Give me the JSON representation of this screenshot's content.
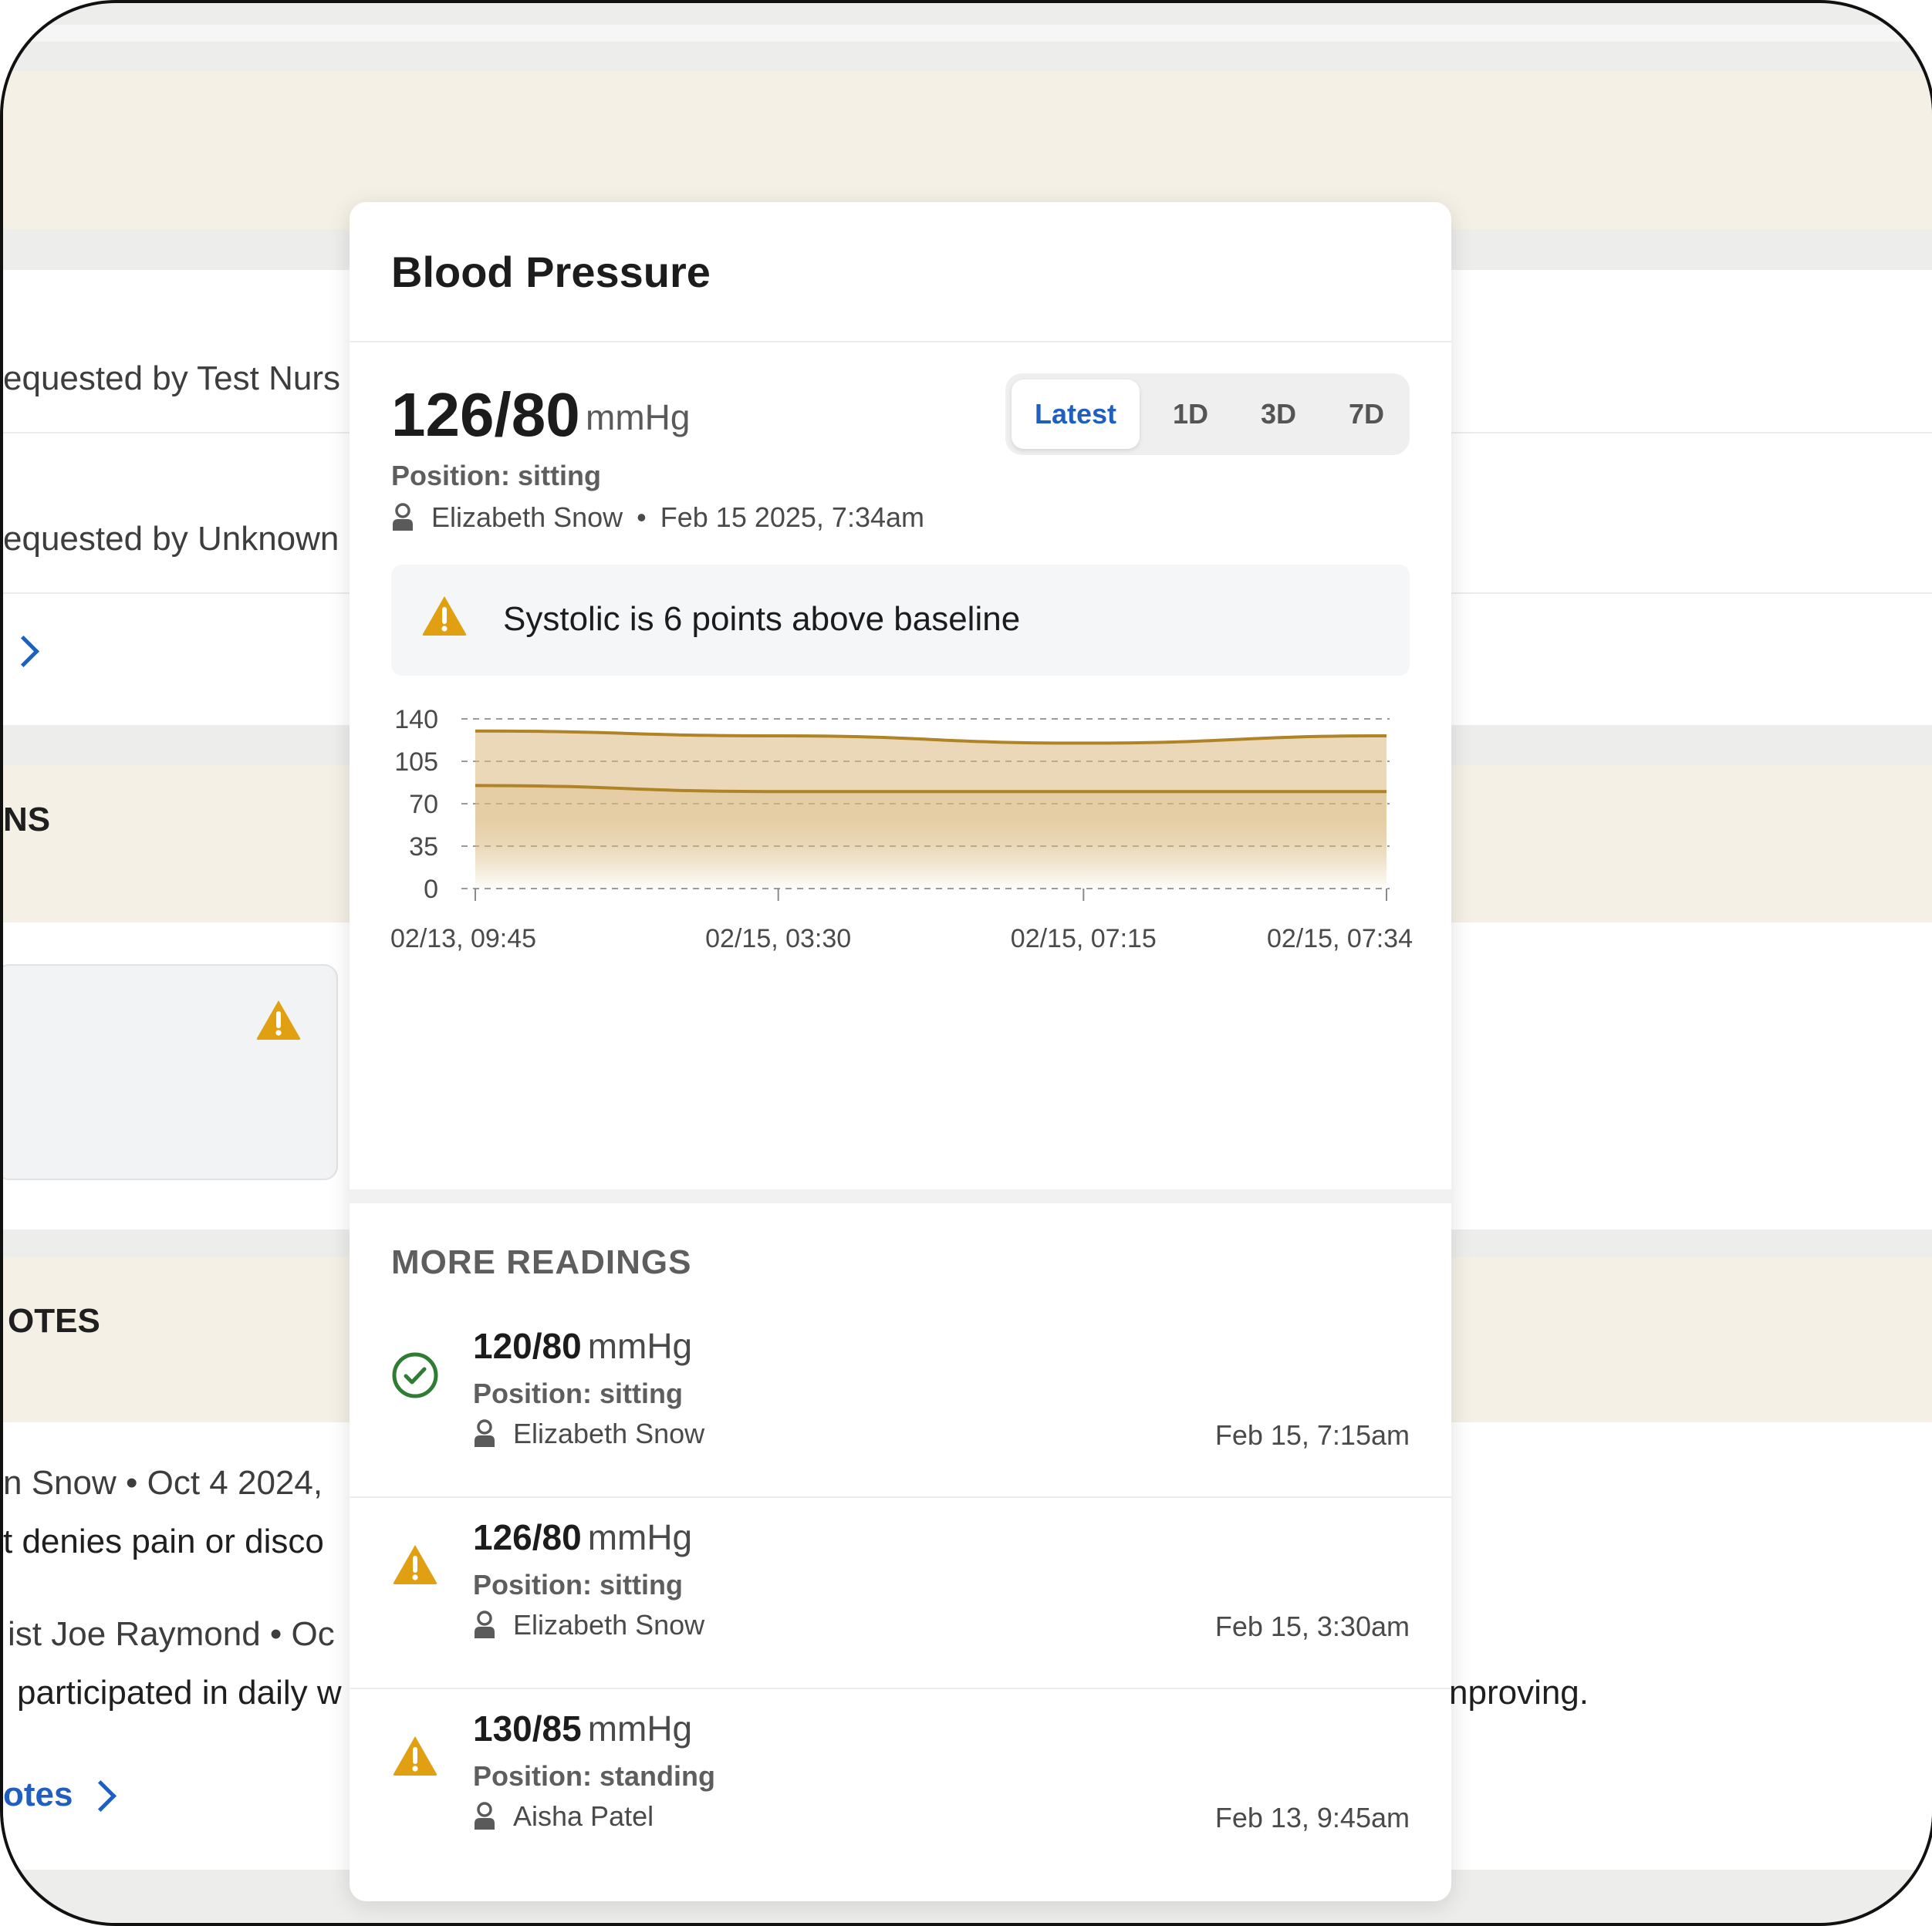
{
  "background": {
    "requested_1": "equested by Test Nurs",
    "requested_2": "equested by Unknown",
    "section_ns": "NS",
    "section_notes": "OTES",
    "note_line_1": "n Snow • Oct 4 2024,",
    "note_line_2": "t denies pain or disco",
    "note_line_3": "ist  Joe Raymond • Oc",
    "note_line_4": "participated in daily w",
    "note_line_4_right": "nproving.",
    "notes_link": "otes"
  },
  "modal": {
    "title": "Blood Pressure",
    "latest_value": "126/80",
    "latest_unit": "mmHg",
    "position": "Position: sitting",
    "author": "Elizabeth Snow",
    "separator": "•",
    "timestamp": "Feb 15 2025, 7:34am",
    "ranges": [
      "Latest",
      "1D",
      "3D",
      "7D"
    ],
    "active_range": "Latest",
    "alert_text": "Systolic is 6 points above baseline",
    "more_readings_title": "MORE READINGS",
    "readings": [
      {
        "value": "120/80",
        "unit": "mmHg",
        "position": "Position: sitting",
        "author": "Elizabeth Snow",
        "time": "Feb 15, 7:15am",
        "status": "normal"
      },
      {
        "value": "126/80",
        "unit": "mmHg",
        "position": "Position: sitting",
        "author": "Elizabeth Snow",
        "time": "Feb 15, 3:30am",
        "status": "warning"
      },
      {
        "value": "130/85",
        "unit": "mmHg",
        "position": "Position: standing",
        "author": "Aisha Patel",
        "time": "Feb 13, 9:45am",
        "status": "warning"
      }
    ]
  },
  "colors": {
    "accent": "#1f5fbf",
    "warning": "#e0a012",
    "ok": "#2e7d32",
    "line": "#b08326",
    "band_bg": "#f4f0e6"
  },
  "chart_data": {
    "type": "area",
    "x": [
      "02/13, 09:45",
      "02/15, 03:30",
      "02/15, 07:15",
      "02/15, 07:34"
    ],
    "series": [
      {
        "values": [
          130,
          126,
          120,
          126
        ]
      },
      {
        "values": [
          85,
          80,
          80,
          80
        ]
      }
    ],
    "yticks": [
      0,
      35,
      70,
      105,
      140
    ],
    "ylim": [
      0,
      140
    ],
    "grid": true
  }
}
